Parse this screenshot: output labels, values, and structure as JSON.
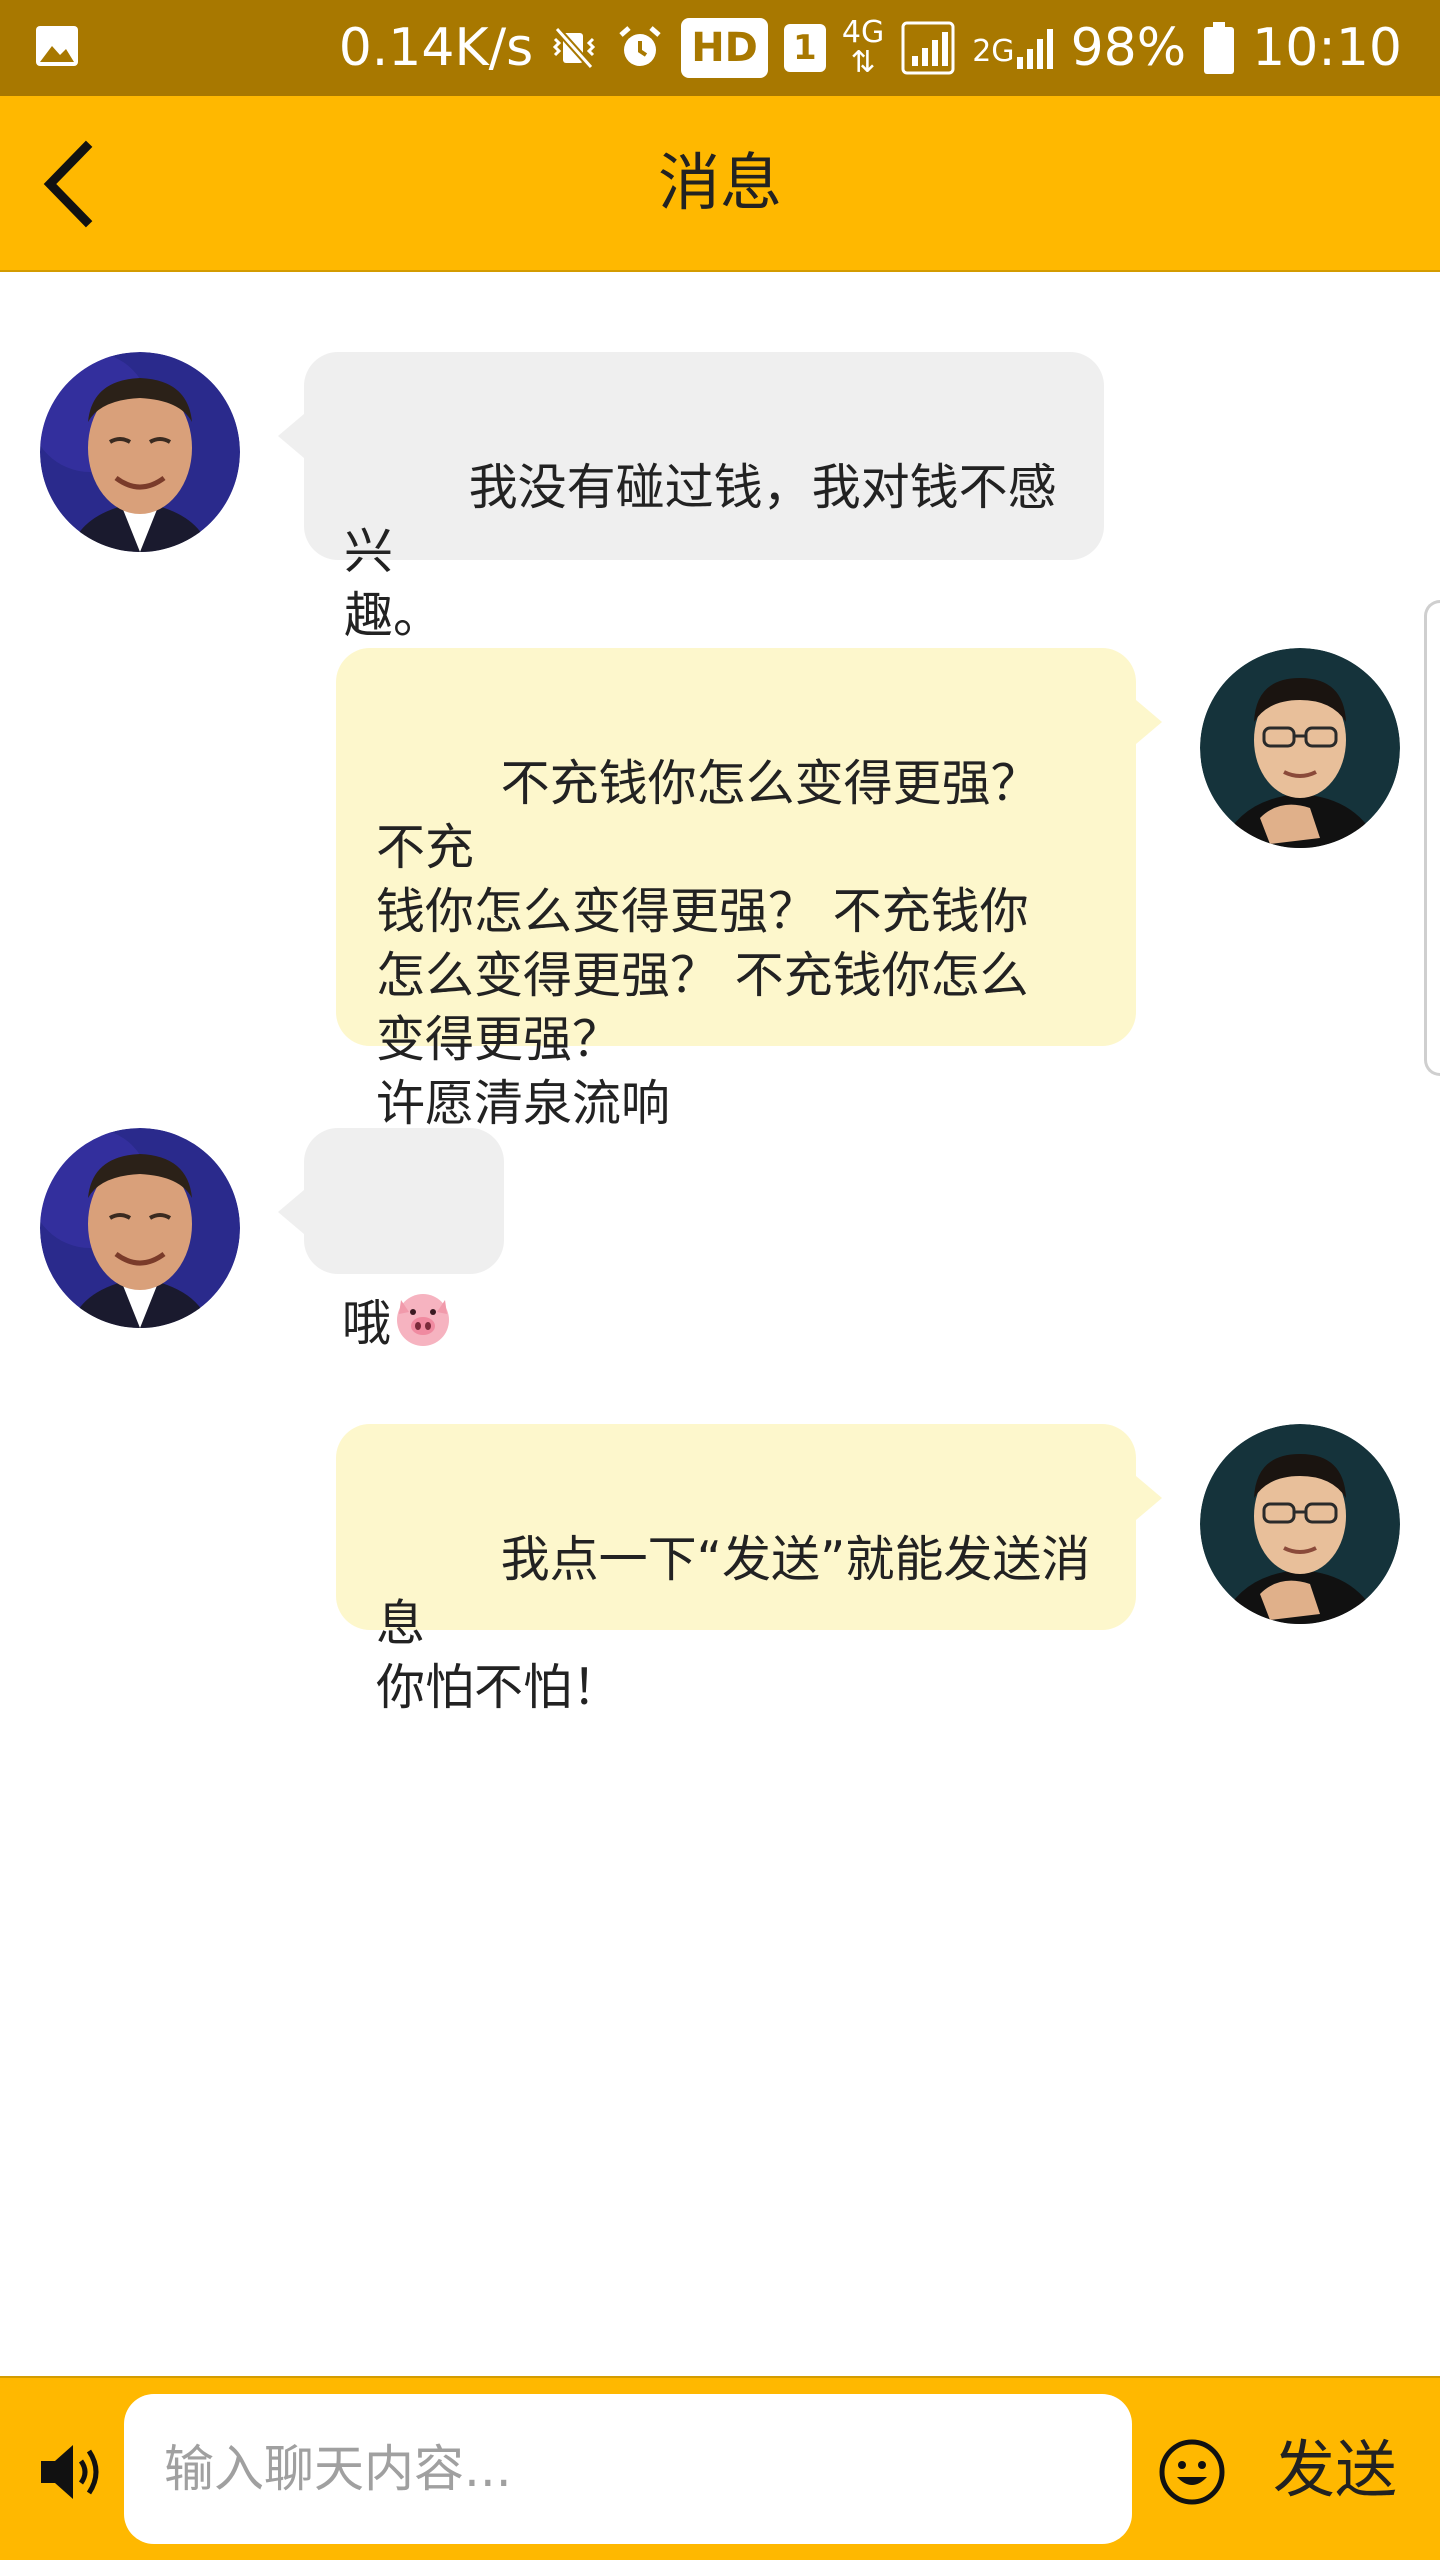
{
  "status_bar": {
    "network_speed": "0.14K/s",
    "hd_badge": "HD",
    "sim_badge": "1",
    "network_4g": "4G",
    "network_2g": "2G",
    "battery": "98%",
    "time": "10:10",
    "icons": [
      "gallery-icon",
      "vibrate-off-icon",
      "alarm-icon",
      "signal-icon",
      "battery-icon"
    ]
  },
  "header": {
    "title": "消息",
    "back_icon": "chevron-left-icon"
  },
  "messages": [
    {
      "side": "left",
      "sender_avatar": "avatar-contact-a",
      "text": "我没有碰过钱，我对钱不感兴\n趣。"
    },
    {
      "side": "right",
      "sender_avatar": "avatar-self",
      "text": "不充钱你怎么变得更强？ 不充\n钱你怎么变得更强？ 不充钱你\n怎么变得更强？ 不充钱你怎么\n变得更强？\n许愿清泉流响"
    },
    {
      "side": "left",
      "sender_avatar": "avatar-contact-a",
      "text": "哦",
      "emoji": "pig-face"
    },
    {
      "side": "right",
      "sender_avatar": "avatar-self",
      "text": "我点一下“发送”就能发送消息\n你怕不怕！"
    }
  ],
  "input_bar": {
    "voice_icon": "speaker-icon",
    "placeholder": "输入聊天内容...",
    "value": "",
    "emoji_icon": "smiley-icon",
    "send_label": "发送"
  },
  "colors": {
    "status_bar": "#a87800",
    "accent": "#ffb800",
    "incoming_bubble": "#efefef",
    "outgoing_bubble": "#fdf7cc"
  }
}
